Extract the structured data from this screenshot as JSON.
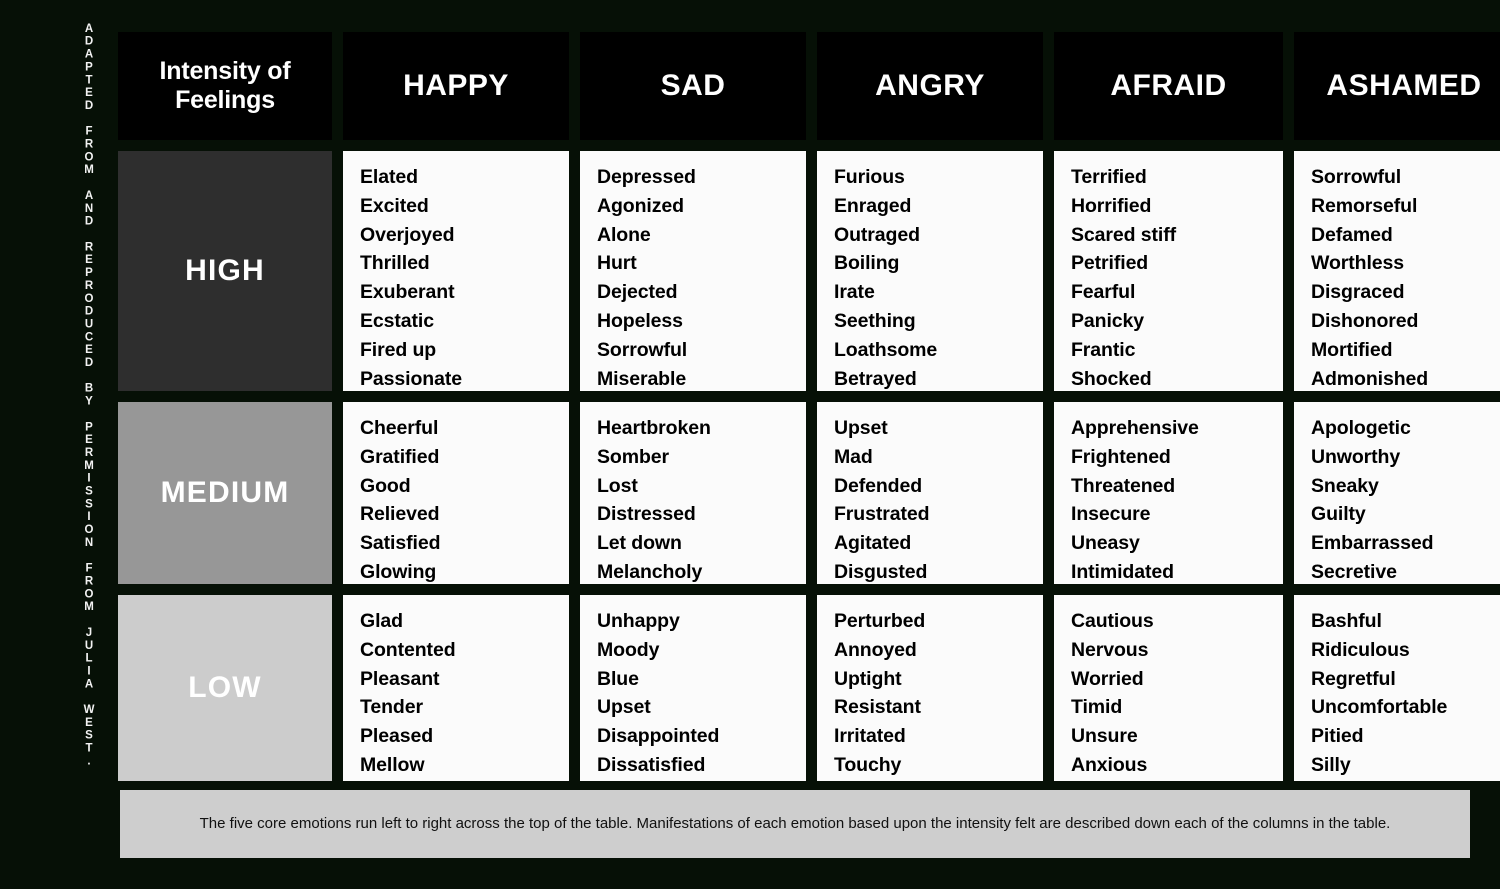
{
  "credit": {
    "text": "ADAPTED FROM AND REPRODUCED BY PERMISSION FROM JULIA WEST."
  },
  "header": {
    "corner_title": "Intensity of Feelings",
    "corner_title_line1": "Intensity of",
    "corner_title_line2": "Feelings",
    "emotions": [
      "HAPPY",
      "SAD",
      "ANGRY",
      "AFRAID",
      "ASHAMED"
    ]
  },
  "colors": {
    "background": "#061006",
    "header_cell": "#000000",
    "cell_bg": "#fbfbfb",
    "high_swatch": "#2e2e2e",
    "medium_swatch": "#979797",
    "low_swatch": "#cccccc",
    "footer_bg": "#cecece",
    "text_light": "#ffffff",
    "text_dark": "#000000"
  },
  "rows": [
    {
      "intensity": "HIGH",
      "swatch": "#2e2e2e",
      "columns": {
        "HAPPY": [
          "Elated",
          "Excited",
          "Overjoyed",
          "Thrilled",
          "Exuberant",
          "Ecstatic",
          "Fired up",
          "Passionate"
        ],
        "SAD": [
          "Depressed",
          "Agonized",
          "Alone",
          "Hurt",
          "Dejected",
          "Hopeless",
          "Sorrowful",
          "Miserable"
        ],
        "ANGRY": [
          "Furious",
          "Enraged",
          "Outraged",
          "Boiling",
          "Irate",
          "Seething",
          "Loathsome",
          "Betrayed"
        ],
        "AFRAID": [
          "Terrified",
          "Horrified",
          "Scared stiff",
          "Petrified",
          "Fearful",
          "Panicky",
          "Frantic",
          "Shocked"
        ],
        "ASHAMED": [
          "Sorrowful",
          "Remorseful",
          "Defamed",
          "Worthless",
          "Disgraced",
          "Dishonored",
          "Mortified",
          "Admonished"
        ]
      }
    },
    {
      "intensity": "MEDIUM",
      "swatch": "#979797",
      "columns": {
        "HAPPY": [
          "Cheerful",
          "Gratified",
          "Good",
          "Relieved",
          "Satisfied",
          "Glowing"
        ],
        "SAD": [
          "Heartbroken",
          "Somber",
          "Lost",
          "Distressed",
          "Let down",
          "Melancholy"
        ],
        "ANGRY": [
          "Upset",
          "Mad",
          "Defended",
          "Frustrated",
          "Agitated",
          "Disgusted"
        ],
        "AFRAID": [
          "Apprehensive",
          "Frightened",
          "Threatened",
          "Insecure",
          "Uneasy",
          "Intimidated"
        ],
        "ASHAMED": [
          "Apologetic",
          "Unworthy",
          "Sneaky",
          "Guilty",
          "Embarrassed",
          "Secretive"
        ]
      }
    },
    {
      "intensity": "LOW",
      "swatch": "#cccccc",
      "columns": {
        "HAPPY": [
          "Glad",
          "Contented",
          "Pleasant",
          "Tender",
          "Pleased",
          "Mellow"
        ],
        "SAD": [
          "Unhappy",
          "Moody",
          "Blue",
          "Upset",
          "Disappointed",
          "Dissatisfied"
        ],
        "ANGRY": [
          "Perturbed",
          "Annoyed",
          "Uptight",
          "Resistant",
          "Irritated",
          "Touchy"
        ],
        "AFRAID": [
          "Cautious",
          "Nervous",
          "Worried",
          "Timid",
          "Unsure",
          "Anxious"
        ],
        "ASHAMED": [
          "Bashful",
          "Ridiculous",
          "Regretful",
          "Uncomfortable",
          "Pitied",
          "Silly"
        ]
      }
    }
  ],
  "footer": {
    "caption": "The five core emotions run left to right across the top of the table. Manifestations of each emotion based upon the intensity felt are described down each of the columns in the table."
  }
}
